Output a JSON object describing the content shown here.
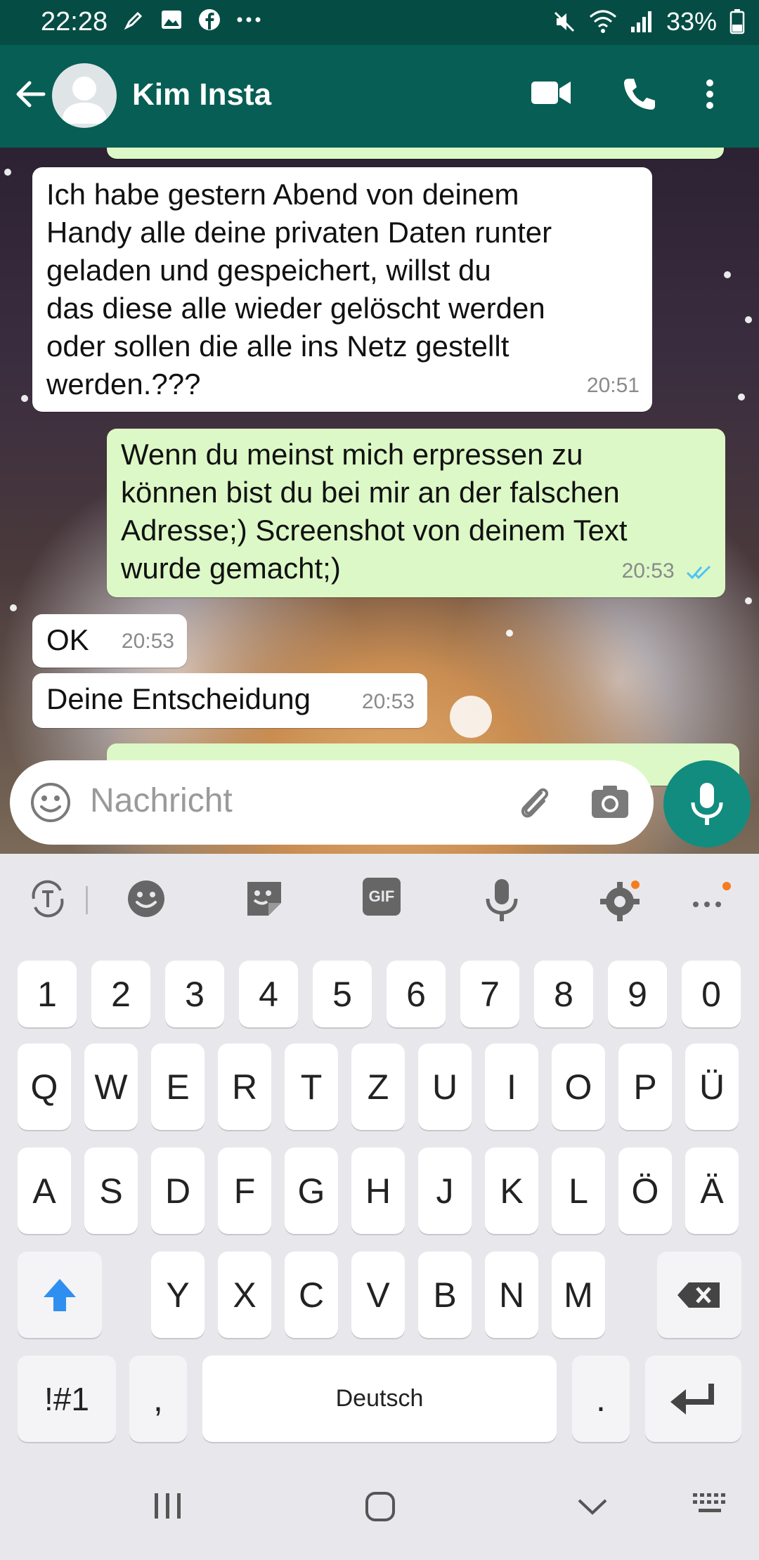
{
  "status_bar": {
    "time": "22:28",
    "left_icons": [
      "pen-icon",
      "image-icon",
      "facebook-icon",
      "more-dots-icon"
    ],
    "right_icons": [
      "mute-icon",
      "wifi-icon",
      "signal-icon"
    ],
    "battery": "33%"
  },
  "app_bar": {
    "contact_name": "Kim Insta",
    "actions": [
      "video-call-icon",
      "voice-call-icon",
      "more-options-icon"
    ]
  },
  "messages": [
    {
      "direction": "in",
      "text": "Ich habe gestern Abend von deinem\nHandy alle deine privaten Daten runter\ngeladen und gespeichert, willst du\ndas diese alle wieder gelöscht werden\noder sollen die alle ins Netz gestellt\nwerden.???",
      "time": "20:51"
    },
    {
      "direction": "out",
      "text": "Wenn du meinst mich erpressen zu\nkönnen bist du bei mir an der falschen\nAdresse;) Screenshot von deinem Text\nwurde gemacht;)",
      "time": "20:53",
      "status": "read"
    },
    {
      "direction": "in",
      "text": "OK",
      "time": "20:53"
    },
    {
      "direction": "in",
      "text": "Deine Entscheidung",
      "time": "20:53"
    }
  ],
  "composer": {
    "placeholder": "Nachricht"
  },
  "keyboard": {
    "toolbar": [
      "text-mode-icon",
      "emoji-icon",
      "sticker-icon",
      "gif-icon",
      "voice-input-icon",
      "settings-icon",
      "more-icon"
    ],
    "gif_label": "GIF",
    "row_numbers": [
      "1",
      "2",
      "3",
      "4",
      "5",
      "6",
      "7",
      "8",
      "9",
      "0"
    ],
    "row_1": [
      "Q",
      "W",
      "E",
      "R",
      "T",
      "Z",
      "U",
      "I",
      "O",
      "P",
      "Ü"
    ],
    "row_2": [
      "A",
      "S",
      "D",
      "F",
      "G",
      "H",
      "J",
      "K",
      "L",
      "Ö",
      "Ä"
    ],
    "row_3": [
      "Y",
      "X",
      "C",
      "V",
      "B",
      "N",
      "M"
    ],
    "symbols_key": "!#1",
    "comma_key": ",",
    "space_label": "Deutsch",
    "period_key": "."
  },
  "colors": {
    "header": "#075e54",
    "status_bar": "#054d44",
    "outgoing_bubble": "#dcf8c6",
    "incoming_bubble": "#ffffff",
    "fab": "#128c7e",
    "read_tick": "#4fc3f7",
    "shift_arrow": "#2f8ff0"
  }
}
